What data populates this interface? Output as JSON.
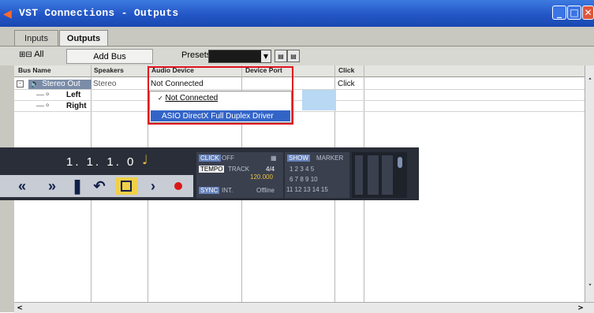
{
  "window": {
    "title": "VST Connections - Outputs"
  },
  "tabs": [
    {
      "label": "Inputs"
    },
    {
      "label": "Outputs"
    }
  ],
  "toolbar": {
    "all_label": "All",
    "add_bus_label": "Add Bus",
    "presets_label": "Presets"
  },
  "columns": {
    "bus_name": "Bus Name",
    "speakers": "Speakers",
    "audio_device": "Audio Device",
    "device_port": "Device Port",
    "click": "Click"
  },
  "rows": {
    "stereo_out": {
      "name": "Stereo Out",
      "speakers": "Stereo",
      "audio_device": "Not Connected",
      "click": "Click"
    },
    "left": {
      "name": "Left"
    },
    "right": {
      "name": "Right"
    }
  },
  "dropdown": {
    "option_not_connected": "Not Connected",
    "option_driver": "ASIO DirectX Full Duplex Driver"
  },
  "transport": {
    "position": "1. 1. 1.  0",
    "click_label": "CLICK",
    "click_value": "OFF",
    "tempo_label": "TEMPO",
    "track_label": "TRACK",
    "signature": "4/4",
    "tempo_value": "120.000",
    "sync_label": "SYNC",
    "sync_mode": "INT.",
    "sync_status": "Offline",
    "show_label": "SHOW",
    "marker_label": "MARKER",
    "markers_row1": "1  2  3  4  5",
    "markers_row2": "6  7  8  9  10",
    "markers_row3": "11 12 13 14 15"
  }
}
